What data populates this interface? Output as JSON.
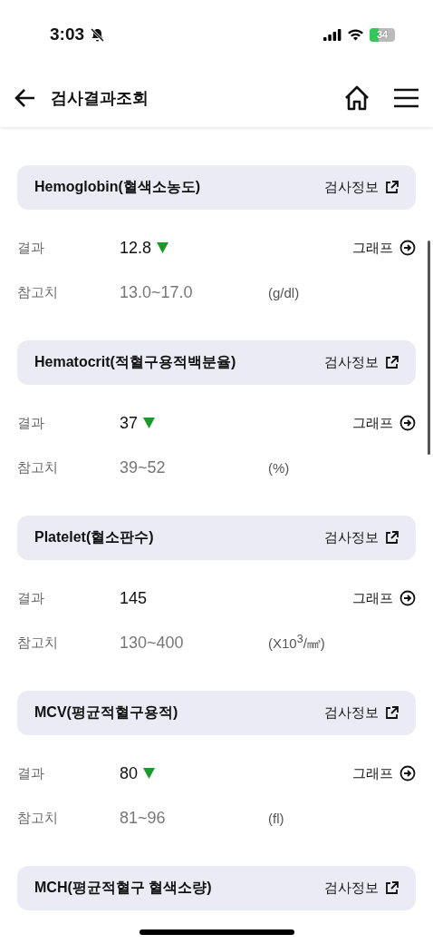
{
  "status_bar": {
    "time": "3:03",
    "battery": "34"
  },
  "header": {
    "title": "검사결과조회"
  },
  "tests": [
    {
      "name": "Hemoglobin(혈색소농도)",
      "info_link": "검사정보",
      "result_label": "결과",
      "result": "12.8",
      "low": true,
      "graph_link": "그래프",
      "reference_label": "참고치",
      "reference": "13.0~17.0",
      "unit": "(g/dl)"
    },
    {
      "name": "Hematocrit(적혈구용적백분율)",
      "info_link": "검사정보",
      "result_label": "결과",
      "result": "37",
      "low": true,
      "graph_link": "그래프",
      "reference_label": "참고치",
      "reference": "39~52",
      "unit": "(%)"
    },
    {
      "name": "Platelet(혈소판수)",
      "info_link": "검사정보",
      "result_label": "결과",
      "result": "145",
      "low": false,
      "graph_link": "그래프",
      "reference_label": "참고치",
      "reference": "130~400",
      "unit": "(X10$^{3}$/㎣)"
    },
    {
      "name": "MCV(평균적혈구용적)",
      "info_link": "검사정보",
      "result_label": "결과",
      "result": "80",
      "low": true,
      "graph_link": "그래프",
      "reference_label": "참고치",
      "reference": "81~96",
      "unit": "(fl)"
    },
    {
      "name": "MCH(평균적혈구 혈색소량)",
      "info_link": "검사정보"
    }
  ]
}
